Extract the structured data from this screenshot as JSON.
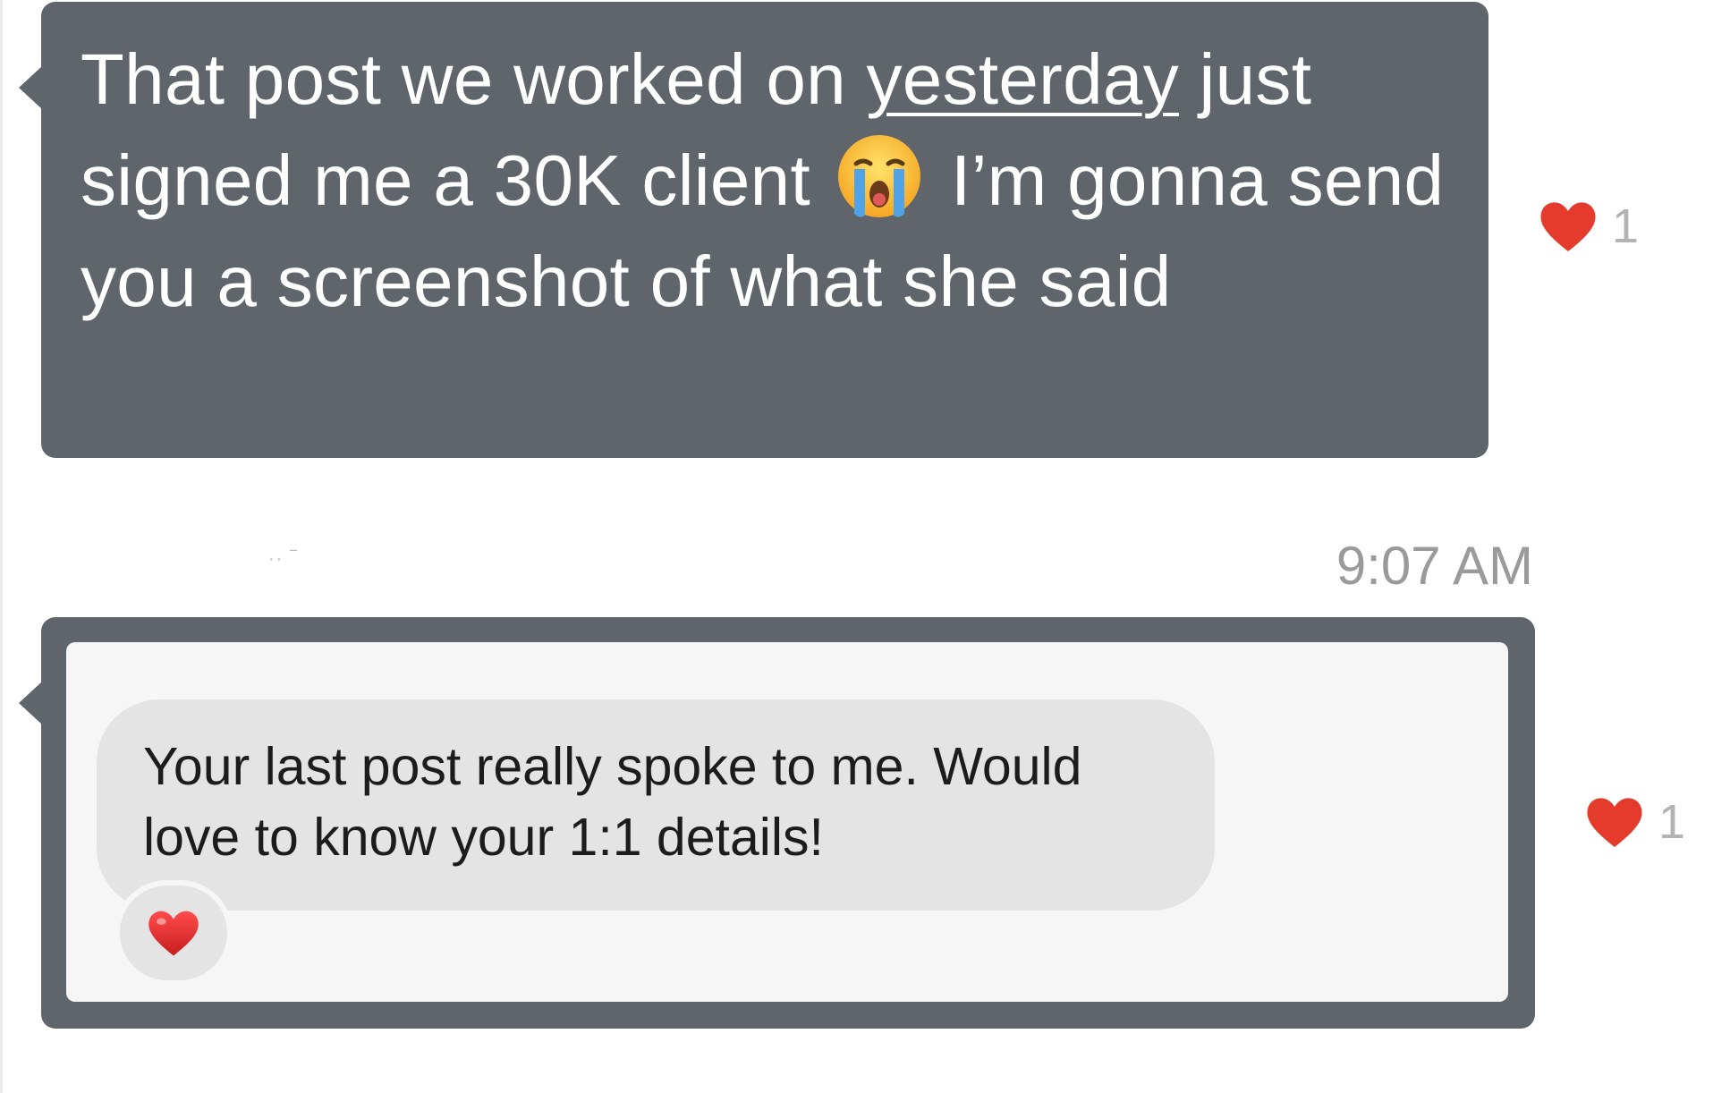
{
  "messages": [
    {
      "text_before": "That post we worked on ",
      "text_underlined": "yesterday",
      "text_middle": " just signed me a 30K client",
      "emoji": "loudly-crying-face-emoji",
      "text_after": " I’m gonna send you a screenshot of what she said",
      "reaction_icon": "heart-icon",
      "reaction_count": "1"
    },
    {
      "embedded_screenshot_text": "Your last post really spoke to me. Would love to know your 1:1 details!",
      "embedded_reaction_icon": "heart-emoji",
      "reaction_icon": "heart-icon",
      "reaction_count": "1"
    }
  ],
  "timestamp": "9:07 AM",
  "colors": {
    "bubble": "#5f656b",
    "heart": "#e53b2c",
    "timestamp": "#9a9a9a"
  }
}
